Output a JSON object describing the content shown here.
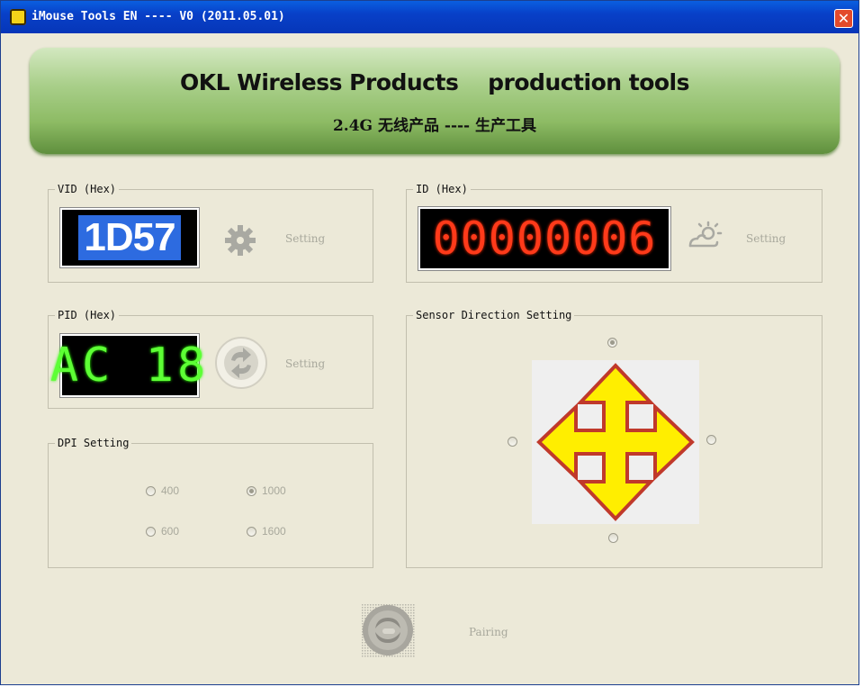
{
  "window": {
    "title": "iMouse Tools EN ---- V0 (2011.05.01)",
    "close_label": "✕"
  },
  "banner": {
    "line1": "OKL Wireless Products    production tools",
    "line2": "2.4G 无线产品 ---- 生产工具"
  },
  "vid": {
    "legend": "VID (Hex)",
    "value": "1D57",
    "setting_label": "Setting",
    "icon": "gear-icon"
  },
  "id": {
    "legend": "ID (Hex)",
    "value": "00000006",
    "setting_label": "Setting",
    "icon": "sun-cloud-icon"
  },
  "pid": {
    "legend": "PID (Hex)",
    "value": "AC 18",
    "setting_label": "Setting",
    "icon": "refresh-icon"
  },
  "dpi": {
    "legend": "DPI Setting",
    "options": [
      "400",
      "1000",
      "600",
      "1600"
    ],
    "selected": "1000"
  },
  "sensor": {
    "legend": "Sensor Direction Setting",
    "selected": "up",
    "icon": "four-way-arrow-icon"
  },
  "pairing": {
    "label": "Pairing",
    "icon": "pairing-button-icon"
  },
  "colors": {
    "title_bar": "#0840c8",
    "banner": "#8dbb64",
    "id_digits": "#ff3a1a",
    "pid_digits": "#5dff35",
    "vid_highlight": "#2d6be0",
    "arrow_fill": "#ffee00",
    "arrow_stroke": "#c0392b"
  }
}
